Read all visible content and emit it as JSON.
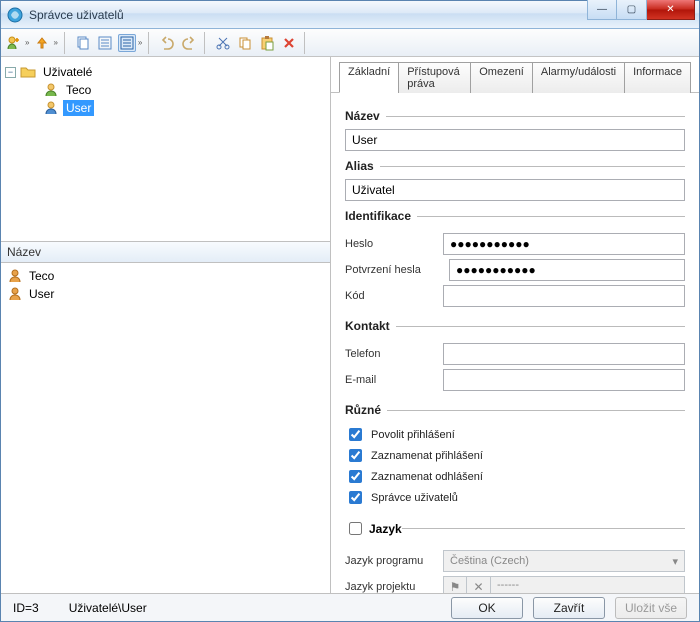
{
  "window": {
    "title": "Správce uživatelů"
  },
  "tree": {
    "root": {
      "label": "Uživatelé"
    },
    "items": [
      {
        "label": "Teco"
      },
      {
        "label": "User"
      }
    ],
    "selected": "User"
  },
  "list": {
    "header": "Název",
    "rows": [
      {
        "label": "Teco"
      },
      {
        "label": "User"
      }
    ]
  },
  "tabs": [
    "Základní",
    "Přístupová práva",
    "Omezení",
    "Alarmy/události",
    "Informace"
  ],
  "form": {
    "nazev": {
      "legend": "Název",
      "value": "User"
    },
    "alias": {
      "legend": "Alias",
      "value": "Uživatel"
    },
    "ident": {
      "legend": "Identifikace",
      "heslo_label": "Heslo",
      "heslo_value": "●●●●●●●●●●●",
      "potvrzeni_label": "Potvrzení hesla",
      "potvrzeni_value": "●●●●●●●●●●●",
      "kod_label": "Kód",
      "kod_value": ""
    },
    "kontakt": {
      "legend": "Kontakt",
      "telefon_label": "Telefon",
      "telefon_value": "",
      "email_label": "E-mail",
      "email_value": ""
    },
    "ruzne": {
      "legend": "Různé",
      "c1": "Povolit přihlášení",
      "c2": "Zaznamenat přihlášení",
      "c3": "Zaznamenat odhlášení",
      "c4": "Správce uživatelů"
    },
    "jazyk": {
      "legend": "Jazyk",
      "prog_label": "Jazyk programu",
      "prog_value": "Čeština (Czech)",
      "proj_label": "Jazyk projektu",
      "proj_value": "------"
    }
  },
  "buttons": {
    "ok": "OK",
    "close": "Zavřít",
    "saveall": "Uložit vše"
  },
  "status": {
    "id": "ID=3",
    "path": "Uživatelé\\User"
  }
}
